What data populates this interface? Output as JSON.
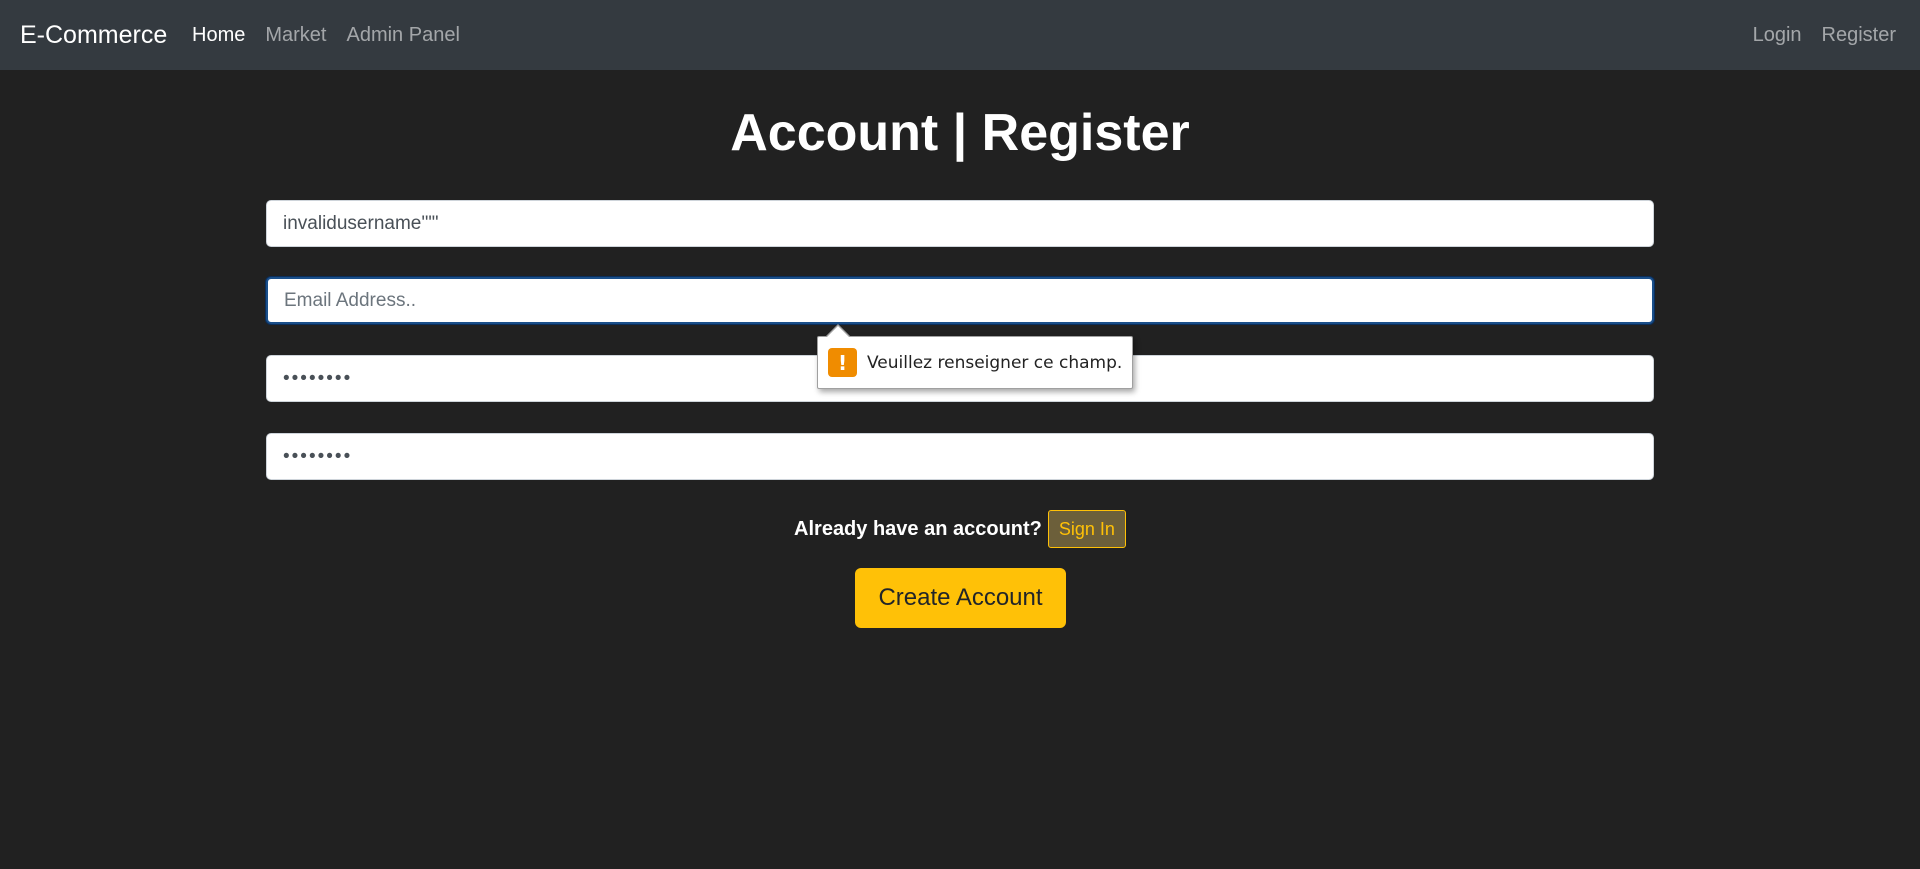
{
  "navbar": {
    "brand": "E-Commerce",
    "left_links": [
      "Home",
      "Market",
      "Admin Panel"
    ],
    "right_links": [
      "Login",
      "Register"
    ]
  },
  "page": {
    "title": "Account | Register"
  },
  "form": {
    "username_value": "invalidusername'\"\"",
    "email_placeholder": "Email Address..",
    "email_value": "",
    "password_value": "••••••••",
    "confirm_password_value": "••••••••",
    "signin_prompt": "Already have an account?",
    "signin_label": "Sign In",
    "submit_label": "Create Account"
  },
  "validation": {
    "message": "Veuillez renseigner ce champ.",
    "icon": "!"
  },
  "colors": {
    "background": "#212121",
    "navbar": "#343a40",
    "accent": "#ffc107",
    "warning_icon": "#f08c00"
  }
}
